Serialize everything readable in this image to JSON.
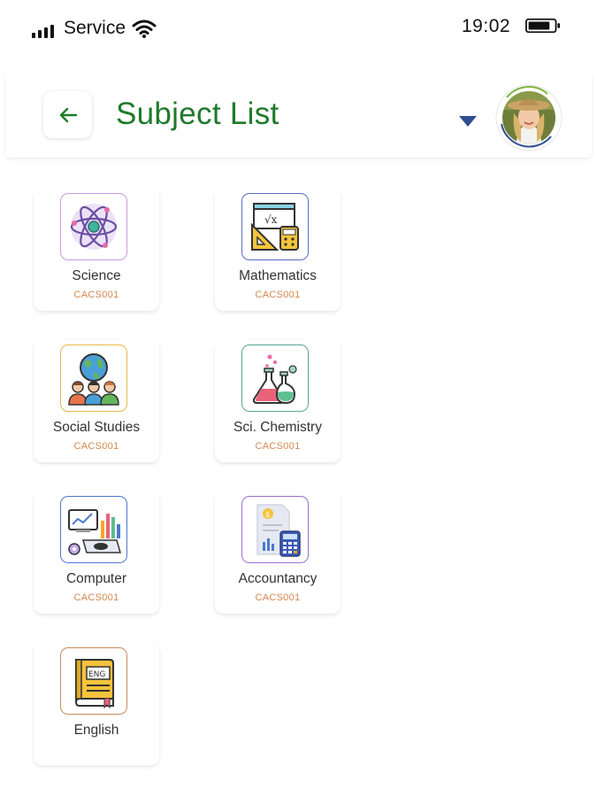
{
  "status_bar": {
    "carrier": "Service",
    "time": "19:02"
  },
  "header": {
    "title": "Subject List"
  },
  "subjects": [
    {
      "name": "Science",
      "code": "CACS001",
      "icon": "atom-icon",
      "border": "#c79be0"
    },
    {
      "name": "Mathematics",
      "code": "CACS001",
      "icon": "math-tools-icon",
      "border": "#5a6fc2"
    },
    {
      "name": "Social Studies",
      "code": "CACS001",
      "icon": "globe-people-icon",
      "border": "#e8b84b"
    },
    {
      "name": "Sci. Chemistry",
      "code": "CACS001",
      "icon": "chemistry-flask-icon",
      "border": "#5aa59a"
    },
    {
      "name": "Computer",
      "code": "CACS001",
      "icon": "computer-analytics-icon",
      "border": "#4d78cf"
    },
    {
      "name": "Accountancy",
      "code": "CACS001",
      "icon": "accounting-calculator-icon",
      "border": "#9b6fcf"
    },
    {
      "name": "English",
      "code": "",
      "icon": "english-book-icon",
      "border": "#c98a5a"
    }
  ],
  "colors": {
    "title": "#1f7a2b",
    "code": "#d4874f",
    "dropdown": "#2f4f93"
  }
}
